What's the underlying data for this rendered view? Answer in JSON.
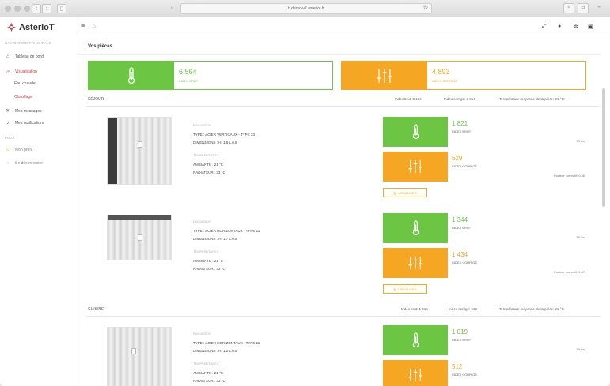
{
  "browser": {
    "url": "b.demo-v2.asteriot.fr"
  },
  "sidebar": {
    "logo": "AsterIoT",
    "nav_header": "NAVIGATION PRINCIPALE",
    "items": [
      {
        "label": "Tableau de bord",
        "icon": "home-icon"
      },
      {
        "label": "Visualisation",
        "icon": "chart-line-icon"
      },
      {
        "label": "Eau chaude"
      },
      {
        "label": "Chauffage"
      },
      {
        "label": "Mes messages",
        "icon": "envelope-icon"
      },
      {
        "label": "Mes notifications",
        "icon": "bell-icon"
      }
    ],
    "plus_header": "PLUS",
    "plus_items": [
      {
        "label": "Mon profil",
        "icon": "user-icon"
      },
      {
        "label": "Se déconnecter",
        "icon": "logout-icon"
      }
    ]
  },
  "page": {
    "title": "Vos pièces"
  },
  "totals": {
    "brut_value": "6 564",
    "brut_label": "INDEX BRUT",
    "corrige_value": "4 893",
    "corrige_label": "INDEX CORRIGÉ"
  },
  "rooms": [
    {
      "name": "SÉJOUR",
      "stat_brut": "Index brut: 3 164",
      "stat_corrige": "Index corrigé: 2 064",
      "stat_temp": "Température moyenne de la pièce: 21 °C",
      "radiators": [
        {
          "rad_label": "RADIATEUR",
          "type": "TYPE : ACIER VERTICAUX - TYPE 33",
          "dims": "DIMENSIONS : H: 1.6 L.0.6",
          "temp_label": "TEMPÉRATURES",
          "ambiante": "AMBIANTE : 21 °C",
          "radiateur": "RADIATEUR : 33 °C",
          "brut_value": "1 821",
          "brut_label": "INDEX BRUT",
          "brut_note": "35 kw",
          "corrige_value": "629",
          "corrige_label": "INDEX CORRIGÉ",
          "corrige_note": "Facteur correctif: 0.86",
          "button": "VISUALISER"
        },
        {
          "rad_label": "RADIATEUR",
          "type": "TYPE : ACIER HORIZONTAUX - TYPE 11",
          "dims": "DIMENSIONS : H: 1.7 L.0.8",
          "temp_label": "TEMPÉRATURES",
          "ambiante": "AMBIANTE : 21 °C",
          "radiateur": "RADIATEUR : 33 °C",
          "brut_value": "1 344",
          "brut_label": "INDEX BRUT",
          "brut_note": "96 kw",
          "corrige_value": "1 434",
          "corrige_label": "INDEX CORRIGÉ",
          "corrige_note": "Facteur correctif: 1.07",
          "button": "VISUALISER"
        }
      ]
    },
    {
      "name": "CUISINE",
      "stat_brut": "Index brut: 1 616",
      "stat_corrige": "Index corrigé: 512",
      "stat_temp": "Température moyenne de la pièce: 21 °C",
      "radiators": [
        {
          "rad_label": "RADIATEUR",
          "type": "TYPE : ACIER HORIZONTAUX - TYPE 11",
          "dims": "DIMENSIONS : H: 1.2 L.0.5",
          "temp_label": "TEMPÉRATURES",
          "ambiante": "AMBIANTE : 21 °C",
          "radiateur": "RADIATEUR : 33 °C",
          "brut_value": "1 019",
          "brut_label": "INDEX BRUT",
          "brut_note": "99 kw",
          "corrige_value": "512",
          "corrige_label": "INDEX CORRIGÉ"
        }
      ]
    }
  ]
}
